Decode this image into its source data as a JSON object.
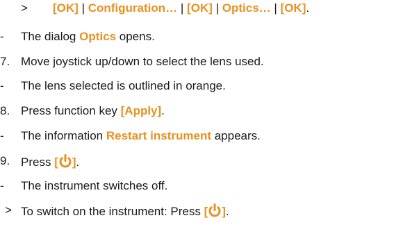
{
  "nav": {
    "marker": ">",
    "items": [
      "[OK]",
      "Configuration…",
      "[OK]",
      "Optics…",
      "[OK]"
    ],
    "separator": "|",
    "end": "."
  },
  "steps": [
    {
      "marker": "-",
      "prefix": "The dialog ",
      "highlight": "Optics",
      "suffix": " opens."
    },
    {
      "marker": "7.",
      "text": "Move joystick up/down to select the lens used."
    },
    {
      "marker": "-",
      "text": "The lens selected is outlined in orange."
    },
    {
      "marker": "8.",
      "prefix": "Press function key ",
      "highlight": "[Apply]",
      "suffix": "."
    },
    {
      "marker": "-",
      "prefix": "The information ",
      "highlight": "Restart instrument",
      "suffix": " appears."
    },
    {
      "marker": "9.",
      "prefix": "Press ",
      "bracket_open": "[",
      "bracket_close": "]",
      "suffix": "."
    },
    {
      "marker": "-",
      "text": "The instrument switches off."
    },
    {
      "marker": ">",
      "prefix": "To switch on the instrument: Press ",
      "bracket_open": "[",
      "bracket_close": "]",
      "suffix": "."
    }
  ],
  "icons": {
    "power": "power-icon"
  },
  "colors": {
    "highlight": "#e8911f",
    "text": "#1a1a1a"
  }
}
